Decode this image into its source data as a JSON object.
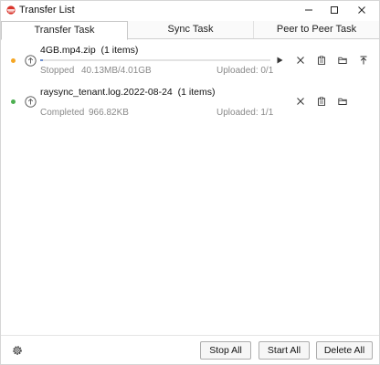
{
  "window": {
    "title": "Transfer List",
    "app_icon": "raysync-logo-icon",
    "controls": [
      "minimize-icon",
      "maximize-icon",
      "close-icon"
    ]
  },
  "tabs": [
    {
      "label": "Transfer Task",
      "active": true
    },
    {
      "label": "Sync Task",
      "active": false
    },
    {
      "label": "Peer to Peer Task",
      "active": false
    }
  ],
  "tasks": [
    {
      "name": "4GB.mp4.zip",
      "items": "(1 items)",
      "status": "Stopped",
      "size": "40.13MB/4.01GB",
      "uploaded": "Uploaded: 0/1",
      "progress": 0.01,
      "dot_color": "#f5a623",
      "actions": [
        "play-icon",
        "close-icon",
        "clipboard-icon",
        "folder-icon",
        "pin-top-icon"
      ]
    },
    {
      "name": "raysync_tenant.log.2022-08-24",
      "items": "(1 items)",
      "status": "Completed",
      "size": "966.82KB",
      "uploaded": "Uploaded: 1/1",
      "dot_color": "#4caf50",
      "actions": [
        "close-icon",
        "clipboard-icon",
        "folder-icon"
      ]
    }
  ],
  "footer": {
    "settings_icon": "gear-icon",
    "stop_all": "Stop All",
    "start_all": "Start All",
    "delete_all": "Delete All"
  }
}
